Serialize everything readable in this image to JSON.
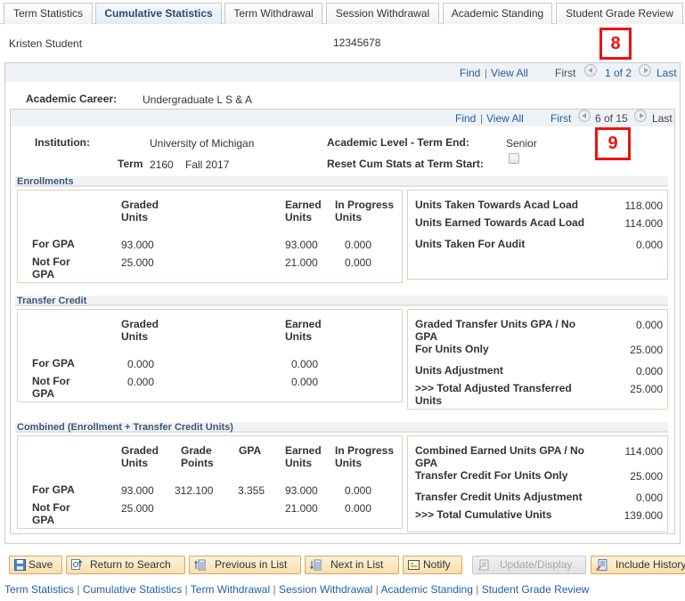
{
  "tabs": [
    {
      "label": "Term Statistics",
      "active": false
    },
    {
      "label": "Cumulative Statistics",
      "active": true
    },
    {
      "label": "Term Withdrawal",
      "active": false
    },
    {
      "label": "Session Withdrawal",
      "active": false
    },
    {
      "label": "Academic Standing",
      "active": false
    },
    {
      "label": "Student Grade Review",
      "active": false
    }
  ],
  "student": {
    "name": "Kristen Student",
    "id": "12345678"
  },
  "callouts": {
    "first": "8",
    "second": "9"
  },
  "outer_nav": {
    "find": "Find",
    "sep": "|",
    "view_all": "View All",
    "first": "First",
    "position": "1 of 2",
    "last": "Last"
  },
  "career": {
    "label": "Academic Career:",
    "value": "Undergraduate L S & A"
  },
  "inner_nav": {
    "find": "Find",
    "sep": "|",
    "view_all": "View All",
    "first": "First",
    "position": "6 of 15",
    "last": "Last"
  },
  "term_info": {
    "institution_label": "Institution:",
    "institution_value": "University of Michigan",
    "term_label": "Term",
    "term_code": "2160",
    "term_desc": "Fall 2017",
    "acad_level_label": "Academic Level - Term End:",
    "acad_level_value": "Senior",
    "reset_label": "Reset Cum Stats at Term Start:",
    "reset_checked": false
  },
  "enrollments": {
    "title": "Enrollments",
    "headers": {
      "graded": "Graded Units",
      "earned": "Earned Units",
      "in_progress": "In Progress Units"
    },
    "rows": [
      {
        "label": "For GPA",
        "graded": "93.000",
        "earned": "93.000",
        "in_progress": "0.000"
      },
      {
        "label": "Not For GPA",
        "graded": "25.000",
        "earned": "21.000",
        "in_progress": "0.000"
      }
    ],
    "summary": [
      {
        "label": "Units Taken Towards Acad Load",
        "value": "118.000"
      },
      {
        "label": "Units Earned Towards Acad Load",
        "value": "114.000"
      },
      {
        "label": "Units Taken For Audit",
        "value": "0.000"
      }
    ]
  },
  "transfer": {
    "title": "Transfer Credit",
    "headers": {
      "graded": "Graded Units",
      "earned": "Earned Units"
    },
    "rows": [
      {
        "label": "For GPA",
        "graded": "0.000",
        "earned": "0.000"
      },
      {
        "label": "Not For GPA",
        "graded": "0.000",
        "earned": "0.000"
      }
    ],
    "summary": [
      {
        "label": "Graded Transfer Units GPA / No GPA",
        "value": "0.000"
      },
      {
        "label": "For Units Only",
        "value": "25.000"
      },
      {
        "label": "Units Adjustment",
        "value": "0.000"
      },
      {
        "label": ">>> Total Adjusted Transferred Units",
        "value": "25.000"
      }
    ]
  },
  "combined": {
    "title": "Combined (Enrollment + Transfer Credit Units)",
    "headers": {
      "graded": "Graded Units",
      "grade_points": "Grade Points",
      "gpa": "GPA",
      "earned": "Earned Units",
      "in_progress": "In Progress Units"
    },
    "rows": [
      {
        "label": "For GPA",
        "graded": "93.000",
        "grade_points": "312.100",
        "gpa": "3.355",
        "earned": "93.000",
        "in_progress": "0.000"
      },
      {
        "label": "Not For GPA",
        "graded": "25.000",
        "grade_points": "",
        "gpa": "",
        "earned": "21.000",
        "in_progress": "0.000"
      }
    ],
    "summary": [
      {
        "label": "Combined Earned Units GPA / No GPA",
        "value": "114.000"
      },
      {
        "label": "Transfer Credit For Units Only",
        "value": "25.000"
      },
      {
        "label": "Transfer Credit Units Adjustment",
        "value": "0.000"
      },
      {
        "label": ">>> Total Cumulative Units",
        "value": "139.000"
      }
    ]
  },
  "toolbar": {
    "save": "Save",
    "return_to_search": "Return to Search",
    "previous_in_list": "Previous in List",
    "next_in_list": "Next in List",
    "notify": "Notify",
    "update_display": "Update/Display",
    "include_history": "Include History"
  },
  "footer_links": {
    "items": [
      "Term Statistics",
      "Cumulative Statistics",
      "Term Withdrawal",
      "Session Withdrawal",
      "Academic Standing",
      "Student Grade Review"
    ],
    "sep": "|"
  },
  "colors": {
    "link": "#1f5fa8",
    "callout": "#ee1111",
    "button_bg": "#f9dfae",
    "button_border": "#e0a756"
  }
}
